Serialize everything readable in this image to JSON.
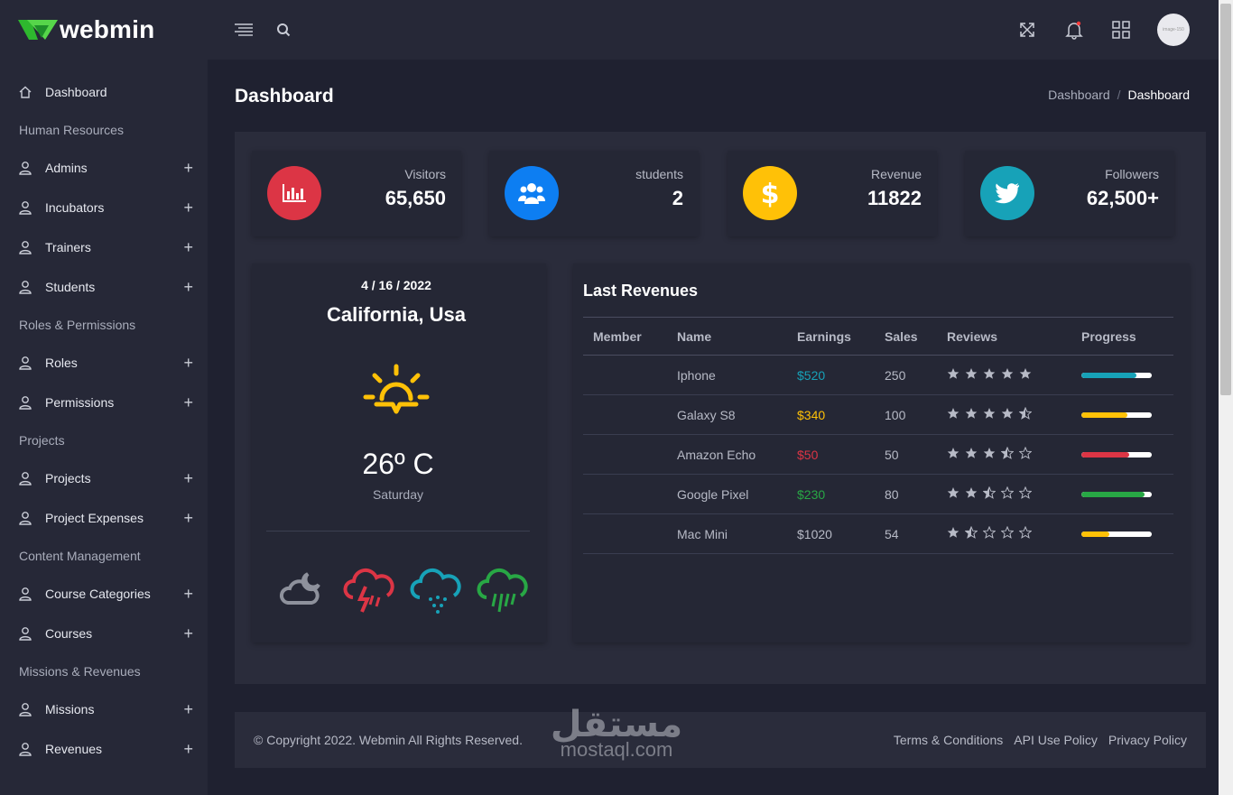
{
  "brand": {
    "name": "webmin"
  },
  "header": {
    "avatar_text": "image-150"
  },
  "sidebar": {
    "items": [
      {
        "type": "item",
        "label": "Dashboard",
        "icon": "home-icon",
        "expand": false
      },
      {
        "type": "header",
        "label": "Human Resources"
      },
      {
        "type": "item",
        "label": "Admins",
        "icon": "user-icon",
        "expand": true
      },
      {
        "type": "item",
        "label": "Incubators",
        "icon": "user-icon",
        "expand": true
      },
      {
        "type": "item",
        "label": "Trainers",
        "icon": "user-icon",
        "expand": true
      },
      {
        "type": "item",
        "label": "Students",
        "icon": "user-icon",
        "expand": true
      },
      {
        "type": "header",
        "label": "Roles & Permissions"
      },
      {
        "type": "item",
        "label": "Roles",
        "icon": "user-icon",
        "expand": true
      },
      {
        "type": "item",
        "label": "Permissions",
        "icon": "user-icon",
        "expand": true
      },
      {
        "type": "header",
        "label": "Projects"
      },
      {
        "type": "item",
        "label": "Projects",
        "icon": "user-icon",
        "expand": true
      },
      {
        "type": "item",
        "label": "Project Expenses",
        "icon": "user-icon",
        "expand": true
      },
      {
        "type": "header",
        "label": "Content Management"
      },
      {
        "type": "item",
        "label": "Course Categories",
        "icon": "user-icon",
        "expand": true
      },
      {
        "type": "item",
        "label": "Courses",
        "icon": "user-icon",
        "expand": true
      },
      {
        "type": "header",
        "label": "Missions & Revenues"
      },
      {
        "type": "item",
        "label": "Missions",
        "icon": "user-icon",
        "expand": true
      },
      {
        "type": "item",
        "label": "Revenues",
        "icon": "user-icon",
        "expand": true
      }
    ]
  },
  "page": {
    "title": "Dashboard",
    "breadcrumb": {
      "parent": "Dashboard",
      "separator": "/",
      "current": "Dashboard"
    }
  },
  "stats": [
    {
      "label": "Visitors",
      "value": "65,650",
      "color": "#dc3545",
      "icon": "bar-chart-icon"
    },
    {
      "label": "students",
      "value": "2",
      "color": "#0d7ef2",
      "icon": "users-icon"
    },
    {
      "label": "Revenue",
      "value": "11822",
      "color": "#ffc107",
      "icon": "dollar-icon"
    },
    {
      "label": "Followers",
      "value": "62,500+",
      "color": "#17a2b8",
      "icon": "twitter-icon"
    }
  ],
  "weather": {
    "date": "4 / 16 / 2022",
    "city": "California, Usa",
    "temperature": "26º C",
    "day": "Saturday",
    "sun_color": "#ffc107",
    "forecast_icons": [
      {
        "icon": "cloud-moon-icon",
        "color": "#8e919c"
      },
      {
        "icon": "storm-icon",
        "color": "#dc3545"
      },
      {
        "icon": "snow-cloud-icon",
        "color": "#17a2b8"
      },
      {
        "icon": "rain-cloud-icon",
        "color": "#28a745"
      }
    ]
  },
  "revenues": {
    "title": "Last Revenues",
    "columns": [
      "Member",
      "Name",
      "Earnings",
      "Sales",
      "Reviews",
      "Progress"
    ],
    "rows": [
      {
        "member": "",
        "name": "Iphone",
        "earnings": "$520",
        "earnings_color": "#17a2b8",
        "sales": "250",
        "rating": 5,
        "half": false,
        "progress": 0.78,
        "progress_color": "#17a2b8"
      },
      {
        "member": "",
        "name": "Galaxy S8",
        "earnings": "$340",
        "earnings_color": "#ffc107",
        "sales": "100",
        "rating": 4,
        "half": true,
        "progress": 0.65,
        "progress_color": "#ffc107"
      },
      {
        "member": "",
        "name": "Amazon Echo",
        "earnings": "$50",
        "earnings_color": "#dc3545",
        "sales": "50",
        "rating": 3,
        "half": true,
        "progress": 0.68,
        "progress_color": "#dc3545"
      },
      {
        "member": "",
        "name": "Google Pixel",
        "earnings": "$230",
        "earnings_color": "#28a745",
        "sales": "80",
        "rating": 2,
        "half": true,
        "progress": 0.9,
        "progress_color": "#28a745"
      },
      {
        "member": "",
        "name": "Mac Mini",
        "earnings": "$1020",
        "earnings_color": "#b7bac6",
        "sales": "54",
        "rating": 1,
        "half": true,
        "progress": 0.4,
        "progress_color": "#ffc107"
      }
    ]
  },
  "footer": {
    "copyright": "© Copyright 2022. Webmin All Rights Reserved.",
    "links": [
      "Terms & Conditions",
      "API Use Policy",
      "Privacy Policy"
    ]
  },
  "watermark": {
    "arabic": "مستقل",
    "latin": "mostaql.com"
  }
}
